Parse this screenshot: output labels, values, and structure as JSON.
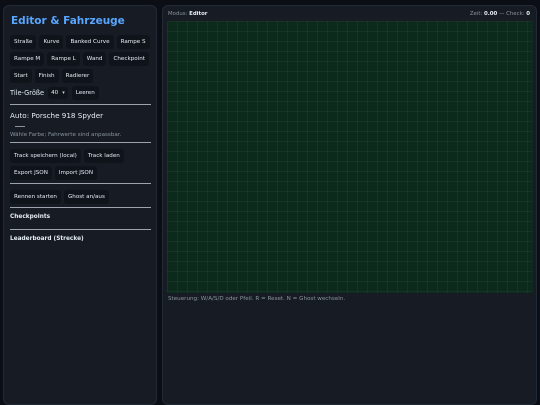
{
  "sidebar": {
    "title": "Editor & Fahrzeuge",
    "tool_rows": [
      [
        "Straße",
        "Kurve",
        "Banked Curve",
        "Rampe S"
      ],
      [
        "Rampe M",
        "Rampe L",
        "Wand",
        "Checkpoint"
      ],
      [
        "Start",
        "Finish",
        "Radierer"
      ]
    ],
    "tile_size_label": "Tile-Größe",
    "tile_size_value": "40",
    "clear_label": "Leeren",
    "car_label": "Auto: Porsche 918 Spyder",
    "car_hint": "Wähle Farbe; Fahrwerte sind anpassbar.",
    "track_buttons": [
      [
        "Track speichern (local)",
        "Track laden"
      ],
      [
        "Export JSON",
        "Import JSON"
      ]
    ],
    "race_buttons": [
      "Rennen starten",
      "Ghost an/aus"
    ],
    "checkpoints_heading": "Checkpoints",
    "leaderboard_heading": "Leaderboard (Strecke)"
  },
  "main": {
    "mode_label": "Modus:",
    "mode_value": "Editor",
    "time_label": "Zeit:",
    "time_value": "0.00",
    "check_label": "— Check:",
    "check_value": "0",
    "controls_hint": "Steuerung: W/A/S/D oder Pfeil. R = Reset. N = Ghost wechseln."
  },
  "colors": {
    "accent": "#58a6ff",
    "canvas": "#0b2a1c",
    "panel": "#161b24",
    "background": "#0b0f15"
  }
}
